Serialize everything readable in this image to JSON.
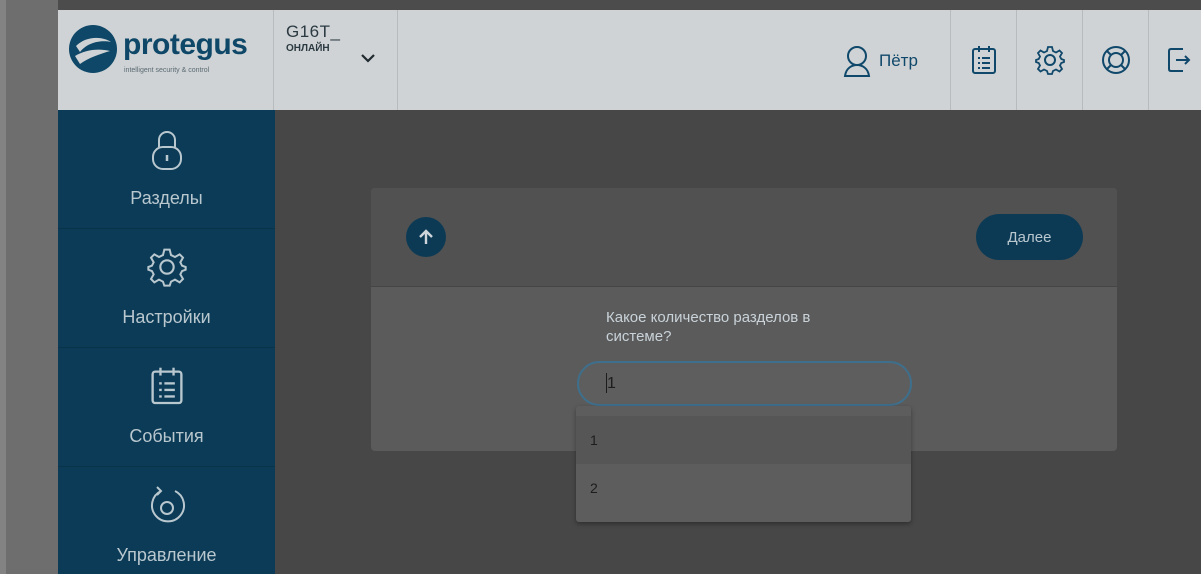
{
  "header": {
    "logo": {
      "wordmark": "protegus",
      "tagline": "intelligent security & control"
    },
    "device": {
      "name": "G16T_",
      "status": "ОНЛАЙН"
    },
    "user": {
      "name": "Пётр"
    },
    "actions": [
      {
        "icon": "events-icon"
      },
      {
        "icon": "gear-icon"
      },
      {
        "icon": "lifebuoy-icon"
      },
      {
        "icon": "logout-icon"
      }
    ]
  },
  "sidebar": {
    "items": [
      {
        "label": "Разделы",
        "icon": "lock-icon"
      },
      {
        "label": "Настройки",
        "icon": "gear-icon"
      },
      {
        "label": "События",
        "icon": "events-icon"
      },
      {
        "label": "Управление",
        "icon": "control-icon"
      }
    ]
  },
  "wizard": {
    "next_label": "Далее",
    "question": "Какое количество разделов в системе?",
    "input_value": "1",
    "options": [
      "1",
      "2"
    ]
  },
  "colors": {
    "sidebar": "#0b3b56",
    "accent": "#0c3a55",
    "overlay": "#474747"
  }
}
